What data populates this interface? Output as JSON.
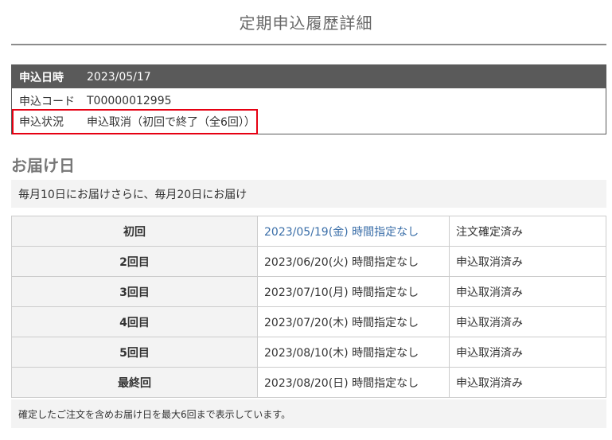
{
  "page": {
    "title": "定期申込履歴詳細"
  },
  "summary": {
    "date_label": "申込日時",
    "date_value": "2023/05/17",
    "code_label": "申込コード",
    "code_value": "T00000012995",
    "status_label": "申込状況",
    "status_value": "申込取消（初回で終了（全6回））"
  },
  "delivery": {
    "heading": "お届け日",
    "schedule": "毎月10日にお届けさらに、毎月20日にお届け",
    "rows": [
      {
        "round": "初回",
        "date": "2023/05/19(金) 時間指定なし",
        "status": "注文確定済み"
      },
      {
        "round": "2回目",
        "date": "2023/06/20(火) 時間指定なし",
        "status": "申込取消済み"
      },
      {
        "round": "3回目",
        "date": "2023/07/10(月) 時間指定なし",
        "status": "申込取消済み"
      },
      {
        "round": "4回目",
        "date": "2023/07/20(木) 時間指定なし",
        "status": "申込取消済み"
      },
      {
        "round": "5回目",
        "date": "2023/08/10(木) 時間指定なし",
        "status": "申込取消済み"
      },
      {
        "round": "最終回",
        "date": "2023/08/20(日) 時間指定なし",
        "status": "申込取消済み"
      }
    ],
    "footnote": "確定したご注文を含めお届け日を最大6回まで表示しています。"
  },
  "colors": {
    "header_bg": "#5a5a5a",
    "highlight": "#e60012",
    "link": "#3a6ea8",
    "cell_bg": "#f3f3f3"
  }
}
